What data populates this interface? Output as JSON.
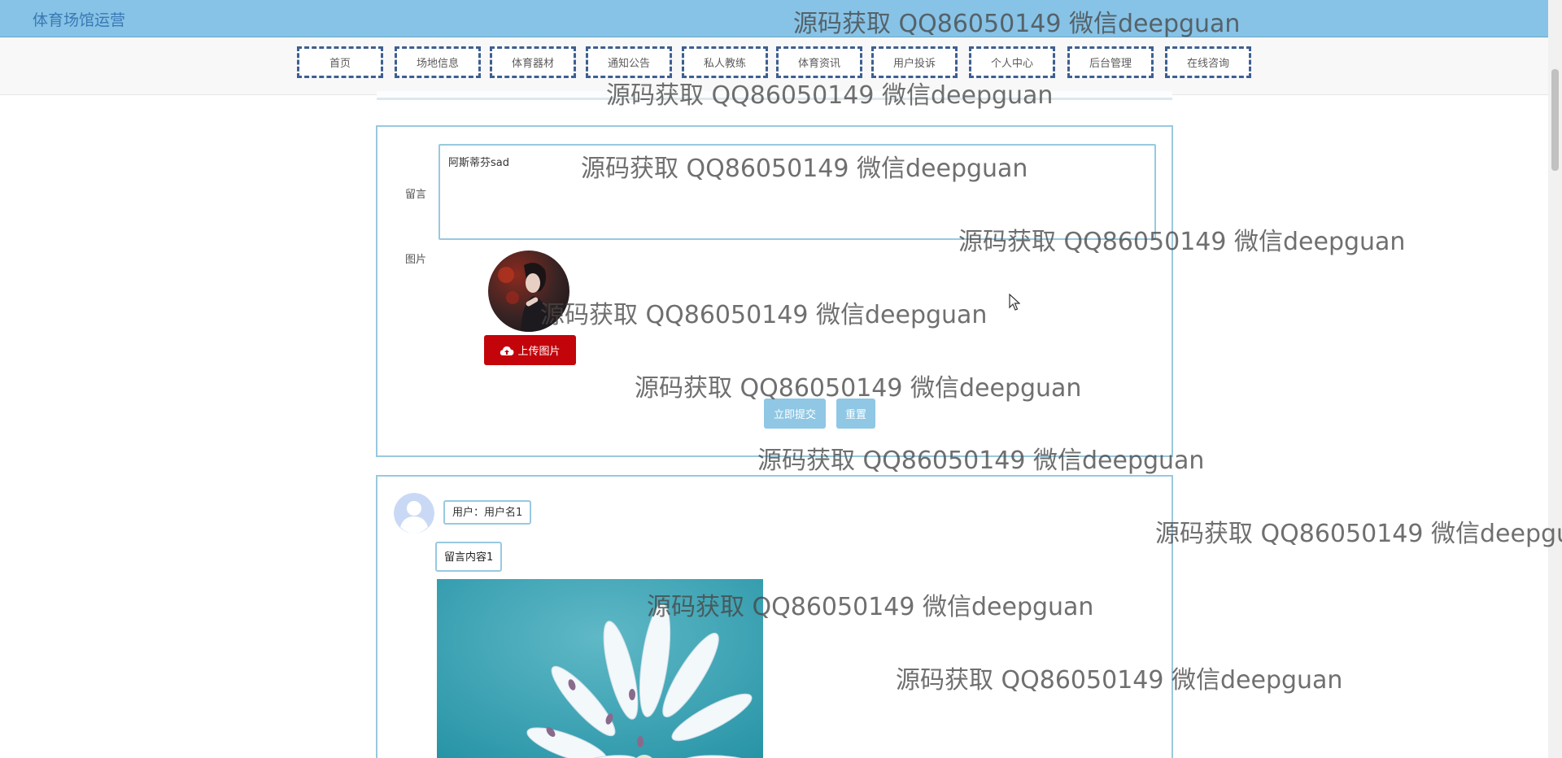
{
  "app": {
    "title": "体育场馆运营"
  },
  "nav": {
    "items": [
      "首页",
      "场地信息",
      "体育器材",
      "通知公告",
      "私人教练",
      "体育资讯",
      "用户投诉",
      "个人中心",
      "后台管理",
      "在线咨询"
    ]
  },
  "form": {
    "message_label": "留言",
    "message_value": "阿斯蒂芬sad",
    "image_label": "图片",
    "upload_button": "上传图片",
    "submit_button": "立即提交",
    "reset_button": "重置"
  },
  "comment": {
    "user": "用户：用户名1",
    "content": "留言内容1"
  },
  "watermark": {
    "text": "源码获取 QQ86050149 微信deepguan",
    "text_cut": "源码获取 QQ86050149 微信deepgu"
  },
  "icons": {
    "upload": "cloud-upload-icon",
    "avatar": "user-avatar-icon"
  },
  "colors": {
    "topbar": "#87c3e6",
    "nav_border": "#3d5f91",
    "card_border": "#98c9df",
    "upload_button": "#c3040b",
    "action_button": "#8fc7e4"
  }
}
